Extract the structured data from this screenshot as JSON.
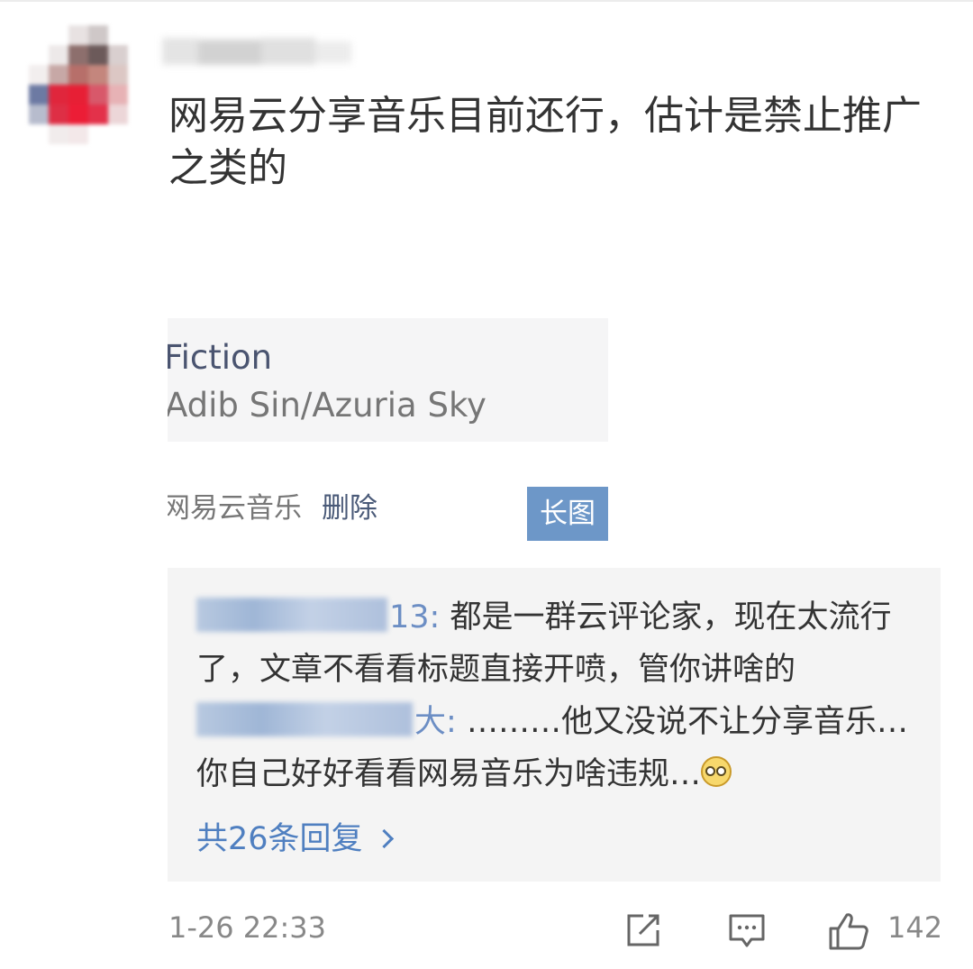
{
  "comment": {
    "text_line1": "网易云分享音乐目前还行，估计是禁止推广",
    "text_line2": "之类的"
  },
  "music_card": {
    "title": "Fiction",
    "artist": "Adib Sin/Azuria Sky"
  },
  "source": {
    "label": "网易云音乐",
    "delete_label": "删除"
  },
  "long_image_button": "长图",
  "replies": [
    {
      "name_tail": "13:",
      "text": "都是一群云评论家，现在太流行了，文章不看看标题直接开喷，管你讲啥的"
    },
    {
      "name_tail": "大:",
      "text": "………他又没说不让分享音乐…你自己好好看看网易音乐为啥违规…"
    }
  ],
  "view_replies": "共26条回复",
  "timestamp": "1-26 22:33",
  "like_count": "142",
  "icons": {
    "share": "share-icon",
    "comment": "comment-icon",
    "like": "thumbs-up-icon",
    "emoji": "confused-face-icon"
  },
  "colors": {
    "link_blue": "#4f7fc0",
    "button_blue": "#6d97c8",
    "reply_bg": "#f4f4f4",
    "card_bg": "#f5f5f6"
  }
}
